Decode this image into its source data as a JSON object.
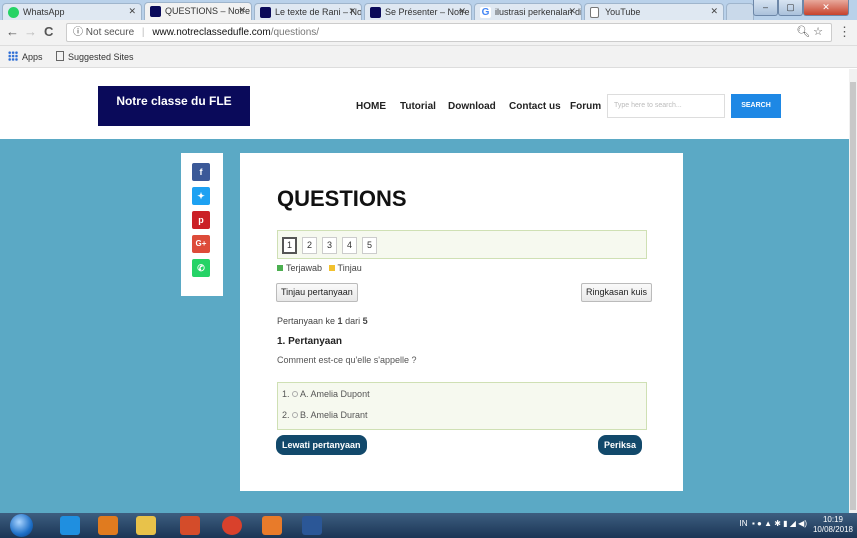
{
  "tabs": [
    {
      "title": "WhatsApp",
      "icon": "whatsapp-icon",
      "color": "#25d366"
    },
    {
      "title": "QUESTIONS – Notre C",
      "icon": "site-favicon",
      "color": "#0a0a5a"
    },
    {
      "title": "Le texte de Rani – Not",
      "icon": "site-favicon",
      "color": "#0a0a5a"
    },
    {
      "title": "Se Présenter – Notre C",
      "icon": "site-favicon",
      "color": "#0a0a5a"
    },
    {
      "title": "ilustrasi perkenalan di",
      "icon": "google-icon",
      "color": "#4285f4"
    },
    {
      "title": "YouTube",
      "icon": "page-icon",
      "color": "#cccccc"
    }
  ],
  "address": {
    "security": "Not secure",
    "host": "www.notreclassedufle.com",
    "path": "/questions/"
  },
  "bookmarks": {
    "apps": "Apps",
    "suggested": "Suggested Sites"
  },
  "site": {
    "logo": "Notre classe du FLE",
    "nav": [
      "HOME",
      "Tutorial",
      "Download",
      "Contact us",
      "Forum"
    ],
    "search_placeholder": "Type here to search...",
    "search_button": "SEARCH"
  },
  "share": [
    {
      "icon": "facebook-icon",
      "glyph": "f",
      "color": "#3b5998"
    },
    {
      "icon": "twitter-icon",
      "glyph": "t",
      "color": "#1da1f2"
    },
    {
      "icon": "pinterest-icon",
      "glyph": "p",
      "color": "#cb2027"
    },
    {
      "icon": "googleplus-icon",
      "glyph": "G+",
      "color": "#dd4b39"
    },
    {
      "icon": "whatsapp-icon",
      "glyph": "w",
      "color": "#25d366"
    }
  ],
  "quiz": {
    "title": "QUESTIONS",
    "pages": [
      "1",
      "2",
      "3",
      "4",
      "5"
    ],
    "current_page": "1",
    "legend": {
      "answered": "Terjawab",
      "review": "Tinjau",
      "answered_color": "#4caf50",
      "review_color": "#f2c12e"
    },
    "review_button": "Tinjau pertanyaan",
    "summary_button": "Ringkasan kuis",
    "progress_prefix": "Pertanyaan ke ",
    "progress_current": "1",
    "progress_mid": " dari ",
    "progress_total": "5",
    "question_heading": "1. Pertanyaan",
    "question_text": "Comment est-ce qu'elle s'appelle ?",
    "answers": [
      {
        "num": "1.",
        "text": "A. Amelia Dupont"
      },
      {
        "num": "2.",
        "text": "B. Amelia Durant"
      }
    ],
    "skip_button": "Lewati pertanyaan",
    "check_button": "Periksa"
  },
  "taskbar": {
    "lang": "IN",
    "time": "10:19",
    "date": "10/08/2018",
    "apps": [
      {
        "icon": "ie-icon",
        "color": "#1f8fe0"
      },
      {
        "icon": "media-player-icon",
        "color": "#e07b1f"
      },
      {
        "icon": "explorer-icon",
        "color": "#e8c24a"
      },
      {
        "icon": "app-icon",
        "color": "#d44c2a"
      },
      {
        "icon": "chrome-icon",
        "color": "#d9412c"
      },
      {
        "icon": "app-g-icon",
        "color": "#e87b2a"
      },
      {
        "icon": "word-icon",
        "color": "#2b5797"
      }
    ]
  }
}
